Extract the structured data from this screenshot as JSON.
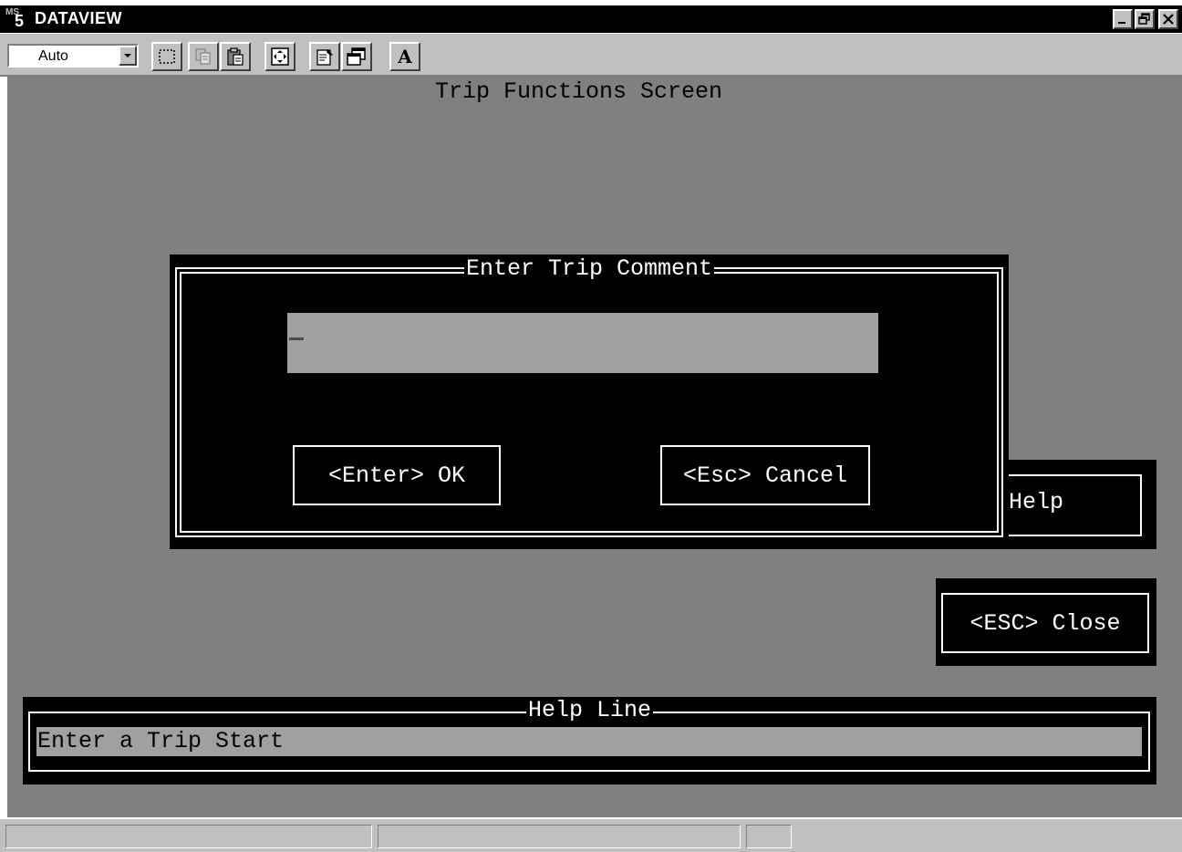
{
  "window": {
    "logo_ms": "MS",
    "logo_five": "5",
    "title": "DATAVIEW",
    "controls": {
      "minimize": "▁",
      "restore": "🗗",
      "close": "✕"
    }
  },
  "toolbar": {
    "font_select": {
      "value": "Auto"
    },
    "buttons": [
      {
        "name": "mark-icon"
      },
      {
        "name": "copy-icon"
      },
      {
        "name": "paste-icon"
      },
      {
        "name": "fullscreen-icon"
      },
      {
        "name": "properties-icon"
      },
      {
        "name": "background-icon"
      },
      {
        "name": "font-icon",
        "glyph": "A"
      }
    ]
  },
  "screen": {
    "title": "Trip Functions Screen"
  },
  "dialog": {
    "title": "Enter Trip Comment",
    "input_value": "",
    "ok_button": "<Enter> OK",
    "cancel_button": "<Esc> Cancel"
  },
  "side_panels": {
    "help_label": "Help",
    "close_label": "<ESC> Close"
  },
  "help_line": {
    "title": "Help Line",
    "text": "Enter a Trip Start"
  },
  "colors": {
    "console_bg": "#808080",
    "field_bg": "#a0a0a0",
    "panel_bg": "#000000",
    "text": "#ffffff"
  }
}
